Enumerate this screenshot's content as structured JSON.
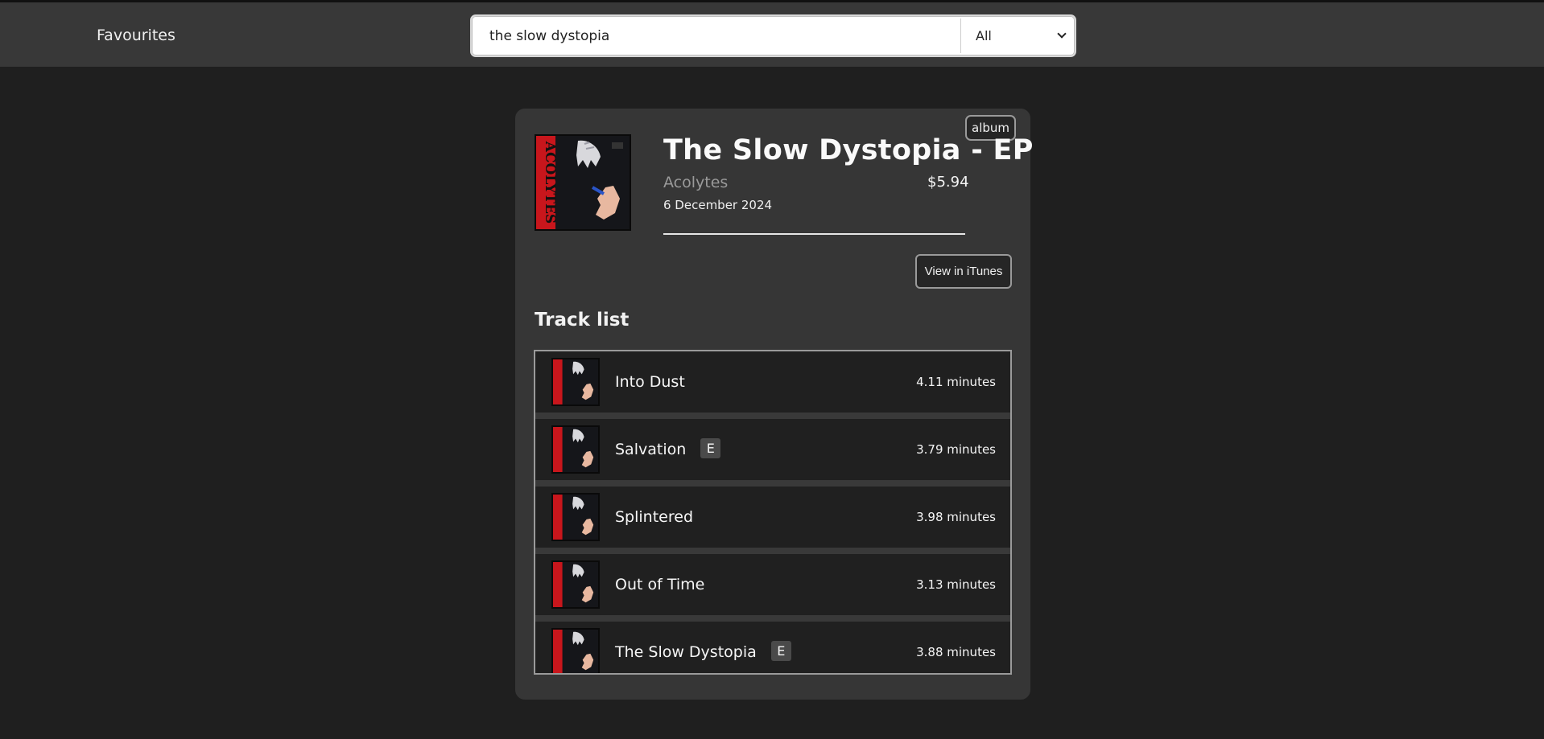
{
  "nav": {
    "brand": "Favourites"
  },
  "search": {
    "value": "the slow dystopia",
    "filter_selected": "All"
  },
  "album": {
    "title": "The Slow Dystopia - EP",
    "artist": "Acolytes",
    "price": "$5.94",
    "release_date": "6 December 2024",
    "type_badge": "album",
    "itunes_button": "View in iTunes",
    "cover_icon": "album-cover-art"
  },
  "tracklist": {
    "heading": "Track list",
    "tracks": [
      {
        "name": "Into Dust",
        "explicit": "",
        "duration": "4.11 minutes"
      },
      {
        "name": "Salvation",
        "explicit": "E",
        "duration": "3.79 minutes"
      },
      {
        "name": "Splintered",
        "explicit": "",
        "duration": "3.98 minutes"
      },
      {
        "name": "Out of Time",
        "explicit": "",
        "duration": "3.13 minutes"
      },
      {
        "name": "The Slow Dystopia",
        "explicit": "E",
        "duration": "3.88 minutes"
      }
    ]
  },
  "colors": {
    "background": "#1f1f1f",
    "navbar": "#383838",
    "card": "#363636",
    "row": "#202020",
    "cover_red": "#c8161c"
  }
}
